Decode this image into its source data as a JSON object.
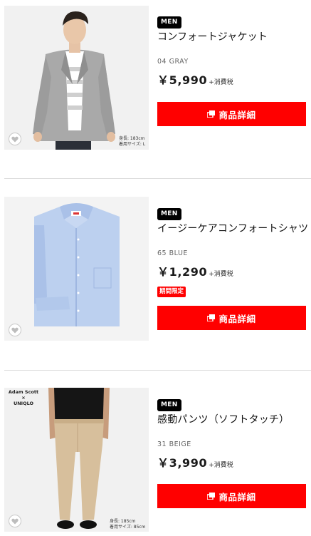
{
  "products": [
    {
      "gender_badge": "MEN",
      "name": "コンフォートジャケット",
      "color": "04 GRAY",
      "price": "￥5,990",
      "tax_note": "+消費税",
      "detail_button": "商品詳細",
      "model_info": [
        "身長: 183cm",
        "着用サイズ: L"
      ],
      "image_icon": "model-in-gray-jacket-photo"
    },
    {
      "gender_badge": "MEN",
      "name": "イージーケアコンフォートシャツ（ス",
      "color": "65 BLUE",
      "price": "￥1,290",
      "tax_note": "+消費税",
      "limited_badge": "期間限定",
      "detail_button": "商品詳細",
      "image_icon": "blue-shirt-photo"
    },
    {
      "gender_badge": "MEN",
      "name": "感動パンツ（ソフトタッチ）",
      "color": "31 BEIGE",
      "price": "￥3,990",
      "tax_note": "+消費税",
      "detail_button": "商品詳細",
      "collab_label": [
        "Adam Scott",
        "×",
        "UNIQLO"
      ],
      "model_info": [
        "身長: 185cm",
        "着用サイズ: 85cm"
      ],
      "image_icon": "model-in-beige-pants-photo"
    }
  ],
  "colors": {
    "accent_red": "#ff0000",
    "badge_black": "#000000",
    "divider": "#dcdcdc"
  }
}
